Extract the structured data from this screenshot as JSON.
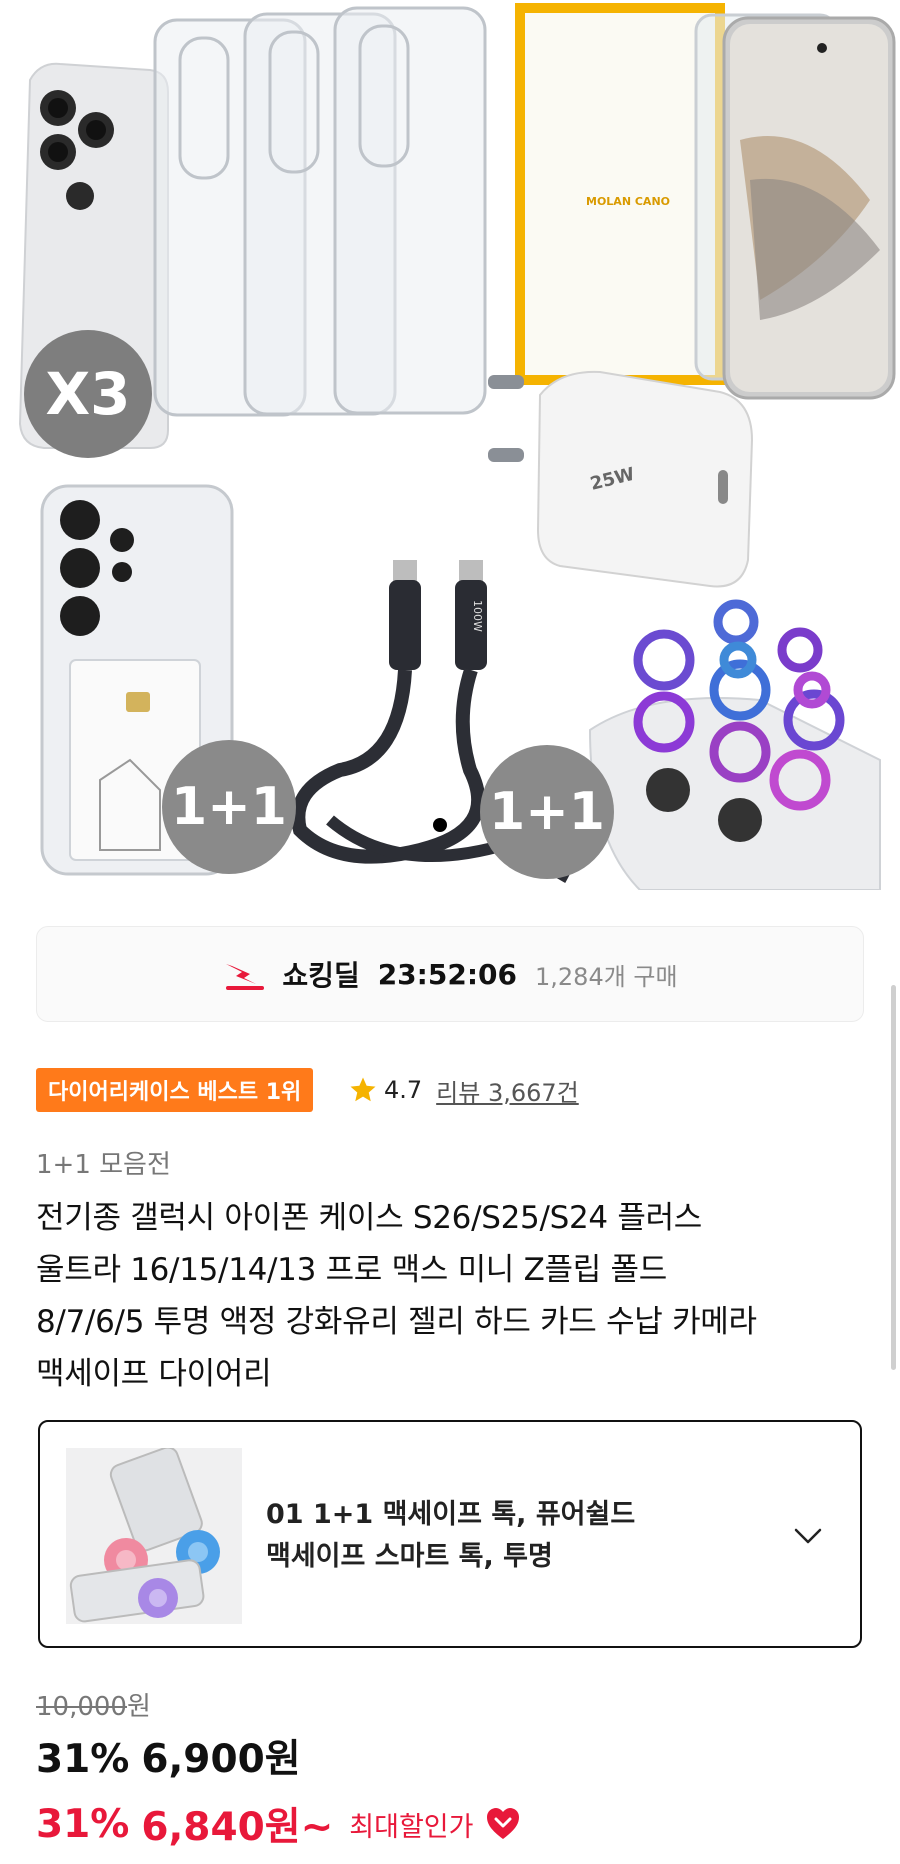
{
  "hero": {
    "badges": [
      "X3",
      "1+1",
      "1+1"
    ],
    "product_labels": {
      "screen_protector_brand": "MOLAN CANO",
      "charger_label": "25W",
      "cable_label": "100W"
    }
  },
  "deal": {
    "icon": "shocking-deal-icon",
    "label": "쇼킹딜",
    "timer": "23:52:06",
    "purchase_count": "1,284개 구매"
  },
  "badge": {
    "label": "다이어리케이스 베스트 1위"
  },
  "rating": {
    "icon": "star-icon",
    "value": "4.7",
    "review_text": "리뷰 3,667건"
  },
  "category": "1+1 모음전",
  "title": {
    "lines": [
      "전기종 갤럭시 아이폰 케이스 S26/S25/S24 플러스",
      "울트라 16/15/14/13 프로 맥스 미니 Z플립 폴드",
      "8/7/6/5 투명 액정 강화유리 젤리 하드 카드 수납 카메라",
      "맥세이프 다이어리"
    ]
  },
  "option": {
    "line1": "01 1+1 맥세이프 톡, 퓨어쉴드",
    "line2": "맥세이프 스마트 톡, 투명",
    "icon": "chevron-down-icon"
  },
  "price": {
    "original": "10,000",
    "original_unit": "원",
    "discount": "31%",
    "sale": "6,900원",
    "max_discount": "31%",
    "max_price": "6,840원~",
    "max_label": "최대할인가",
    "max_icon": "chevron-down-circle-icon"
  },
  "colors": {
    "accent_red": "#e8183a",
    "badge_orange": "#ff7a1a",
    "star": "#f5b301"
  }
}
